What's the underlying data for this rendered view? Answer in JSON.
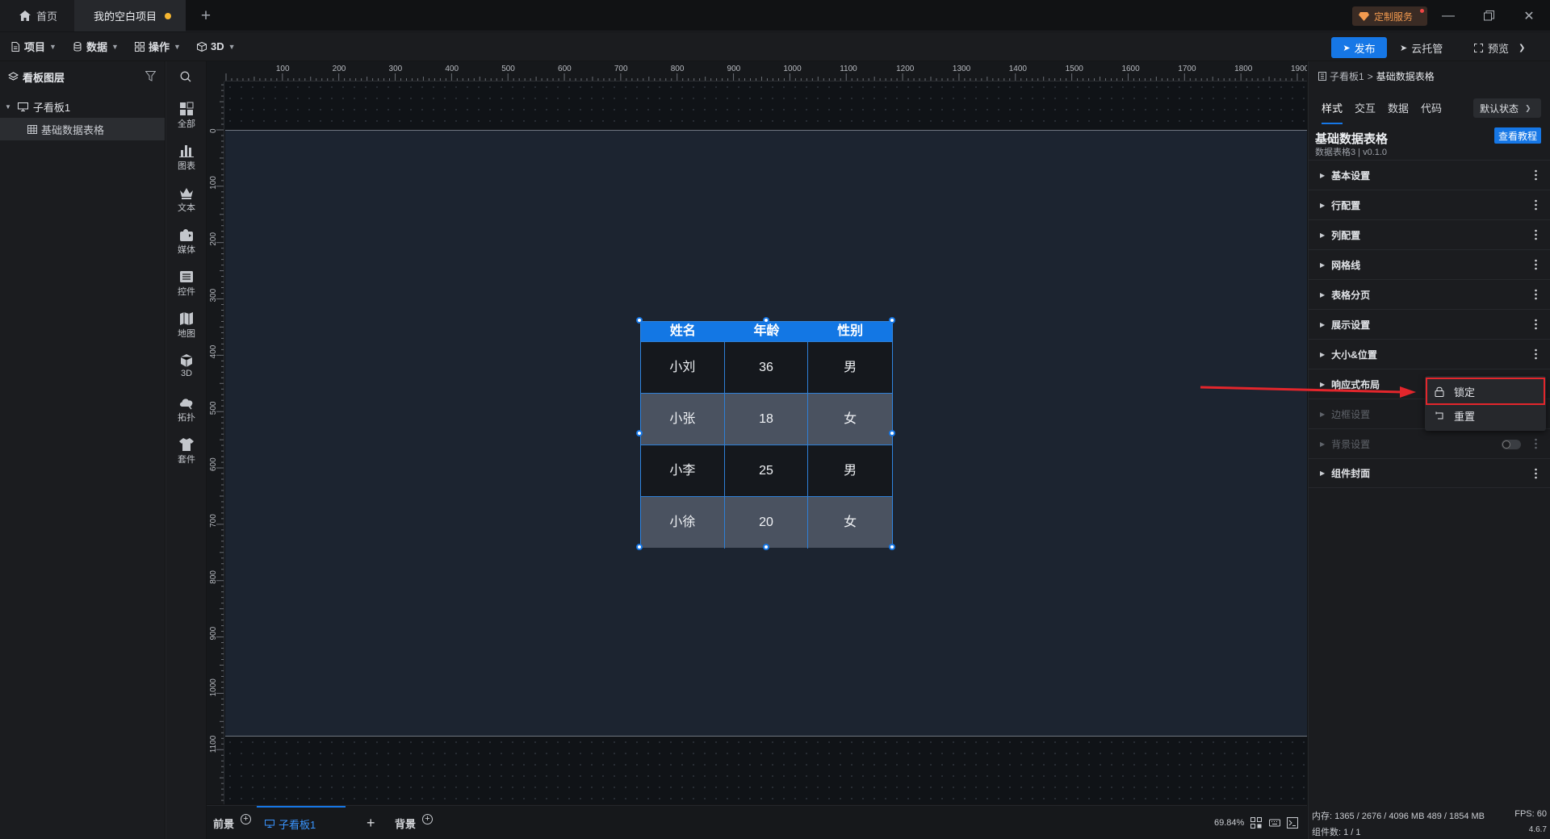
{
  "window": {
    "home_tab": "首页",
    "project_tab": "我的空白项目",
    "custom_service": "定制服务",
    "accent_color": "#1677e6",
    "unsaved_dot_color": "#f5b631"
  },
  "toolbar": {
    "menus": [
      "项目",
      "数据",
      "操作",
      "3D"
    ],
    "publish": "发布",
    "cloud": "云托管",
    "preview": "预览"
  },
  "layers": {
    "title": "看板图层",
    "board": "子看板1",
    "component": "基础数据表格"
  },
  "categories": [
    "全部",
    "图表",
    "文本",
    "媒体",
    "控件",
    "地图",
    "3D",
    "拓扑",
    "套件"
  ],
  "ruler": {
    "top": [
      "100",
      "200",
      "300",
      "400",
      "500",
      "600",
      "700",
      "800",
      "900",
      "1000",
      "1100",
      "1200",
      "1300",
      "1400",
      "1500",
      "1600",
      "1700",
      "1800",
      "1900"
    ],
    "left": [
      "0",
      "100",
      "200",
      "300",
      "400",
      "500",
      "600",
      "700",
      "800",
      "900",
      "1000",
      "1100"
    ]
  },
  "table": {
    "headers": [
      "姓名",
      "年龄",
      "性别"
    ],
    "rows": [
      [
        "小刘",
        "36",
        "男"
      ],
      [
        "小张",
        "18",
        "女"
      ],
      [
        "小李",
        "25",
        "男"
      ],
      [
        "小徐",
        "20",
        "女"
      ]
    ],
    "header_color": "#1377e4"
  },
  "bottom": {
    "foreground": "前景",
    "board_tab": "子看板1",
    "add": "+",
    "background": "背景",
    "zoom": "69.84%"
  },
  "props": {
    "crumb_parent": "子看板1",
    "crumb_sep": ">",
    "crumb_current": "基础数据表格",
    "tabs": [
      "样式",
      "交互",
      "数据",
      "代码"
    ],
    "state": "默认状态",
    "component_title": "基础数据表格",
    "component_version": "数据表格3 | v0.1.0",
    "tutorial": "查看教程",
    "sections": [
      "基本设置",
      "行配置",
      "列配置",
      "网格线",
      "表格分页",
      "展示设置",
      "大小&位置",
      "响应式布局",
      "边框设置",
      "背景设置",
      "组件封面"
    ],
    "status_memory": "内存: 1365 / 2676 / 4096 MB  489 / 1854 MB",
    "status_fps": "FPS: 60",
    "status_count": "组件数: 1 / 1",
    "version": "4.6.7"
  },
  "context_menu": {
    "lock": "锁定",
    "reset": "重置",
    "highlight_color": "#e3262c"
  }
}
